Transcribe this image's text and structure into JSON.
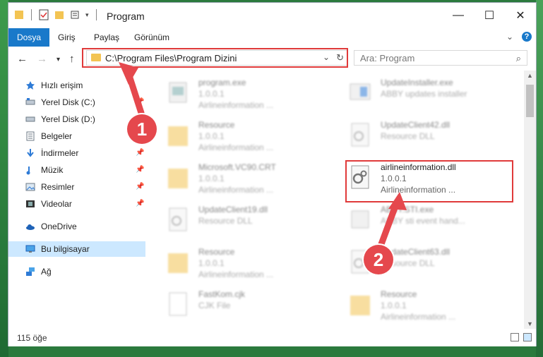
{
  "window": {
    "title": "Program",
    "controls": {
      "minimize": "—",
      "maximize": "☐",
      "close": "✕"
    }
  },
  "ribbon": {
    "tabs": [
      "Dosya",
      "Giriş",
      "Paylaş",
      "Görünüm"
    ],
    "help": "?"
  },
  "navigation": {
    "address_path": "C:\\Program Files\\Program Dizini",
    "search_placeholder": "Ara: Program"
  },
  "sidebar": {
    "items": [
      {
        "label": "Hızlı erişim",
        "icon": "star-icon",
        "pinned": false
      },
      {
        "label": "Yerel Disk (C:)",
        "icon": "drive-icon",
        "pinned": true
      },
      {
        "label": "Yerel Disk (D:)",
        "icon": "drive-icon",
        "pinned": true
      },
      {
        "label": "Belgeler",
        "icon": "documents-icon",
        "pinned": true
      },
      {
        "label": "İndirmeler",
        "icon": "download-icon",
        "pinned": true
      },
      {
        "label": "Müzik",
        "icon": "music-icon",
        "pinned": true
      },
      {
        "label": "Resimler",
        "icon": "pictures-icon",
        "pinned": true
      },
      {
        "label": "Videolar",
        "icon": "video-icon",
        "pinned": true
      },
      {
        "label": "OneDrive",
        "icon": "cloud-icon",
        "pinned": false
      },
      {
        "label": "Bu bilgisayar",
        "icon": "computer-icon",
        "pinned": false,
        "selected": true
      },
      {
        "label": "Ağ",
        "icon": "network-icon",
        "pinned": false
      }
    ]
  },
  "files": [
    {
      "name": "program.exe",
      "line2": "1.0.0.1",
      "line3": "Airlineinformation ...",
      "type": "exe",
      "blurred": true
    },
    {
      "name": "UpdateInstaller.exe",
      "line2": "ABBY updates installer",
      "line3": "",
      "type": "exe",
      "blurred": true
    },
    {
      "name": "Resource",
      "line2": "1.0.0.1",
      "line3": "Airlineinformation ...",
      "type": "folder",
      "blurred": true
    },
    {
      "name": "UpdateClient42.dll",
      "line2": "Resource DLL",
      "line3": "",
      "type": "dll",
      "blurred": true
    },
    {
      "name": "Microsoft.VC90.CRT",
      "line2": "1.0.0.1",
      "line3": "Airlineinformation ...",
      "type": "folder",
      "blurred": true
    },
    {
      "name": "airlineinformation.dll",
      "line2": "1.0.0.1",
      "line3": "Airlineinformation ...",
      "type": "dll",
      "blurred": false
    },
    {
      "name": "UpdateClient19.dll",
      "line2": "Resource DLL",
      "line3": "",
      "type": "dll",
      "blurred": true
    },
    {
      "name": "ABBY.STI.exe",
      "line2": "ABBY sti event hand...",
      "line3": "",
      "type": "exe",
      "blurred": true
    },
    {
      "name": "Resource",
      "line2": "1.0.0.1",
      "line3": "Airlineinformation ...",
      "type": "folder",
      "blurred": true
    },
    {
      "name": "UpdateClient63.dll",
      "line2": "Resource DLL",
      "line3": "",
      "type": "dll",
      "blurred": true
    },
    {
      "name": "FastKom.cjk",
      "line2": "CJK File",
      "line3": "",
      "type": "file",
      "blurred": true
    },
    {
      "name": "Resource",
      "line2": "1.0.0.1",
      "line3": "Airlineinformation ...",
      "type": "folder",
      "blurred": true
    }
  ],
  "status": {
    "item_count": "115 öğe"
  },
  "annotations": {
    "badge1": "1",
    "badge2": "2",
    "accent": "#e5484d"
  }
}
